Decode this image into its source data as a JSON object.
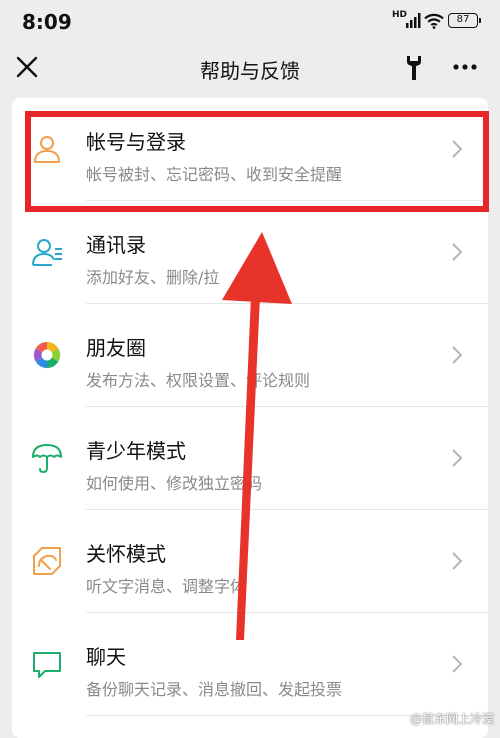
{
  "status_bar": {
    "time": "8:09",
    "network": "HD",
    "battery": "87"
  },
  "nav": {
    "title": "帮助与反馈"
  },
  "items": [
    {
      "title": "帐号与登录",
      "subtitle": "帐号被封、忘记密码、收到安全提醒",
      "icon": "user-outline-icon"
    },
    {
      "title": "通讯录",
      "subtitle": "添加好友、删除/拉",
      "icon": "contacts-icon"
    },
    {
      "title": "朋友圈",
      "subtitle": "发布方法、权限设置、评论规则",
      "icon": "moments-aperture-icon"
    },
    {
      "title": "青少年模式",
      "subtitle": "如何使用、修改独立密码",
      "icon": "umbrella-icon"
    },
    {
      "title": "关怀模式",
      "subtitle": "听文字消息、调整字体",
      "icon": "care-mode-icon"
    },
    {
      "title": "聊天",
      "subtitle": "备份聊天记录、消息撤回、发起投票",
      "icon": "chat-bubble-icon"
    }
  ],
  "watermark": "@鼠东网上冷漠",
  "colors": {
    "highlight": "#e8262a",
    "arrow": "#e8332a",
    "accent_orange": "#f0a14a",
    "accent_blue": "#2aa7c9",
    "accent_green": "#1aad6b"
  }
}
